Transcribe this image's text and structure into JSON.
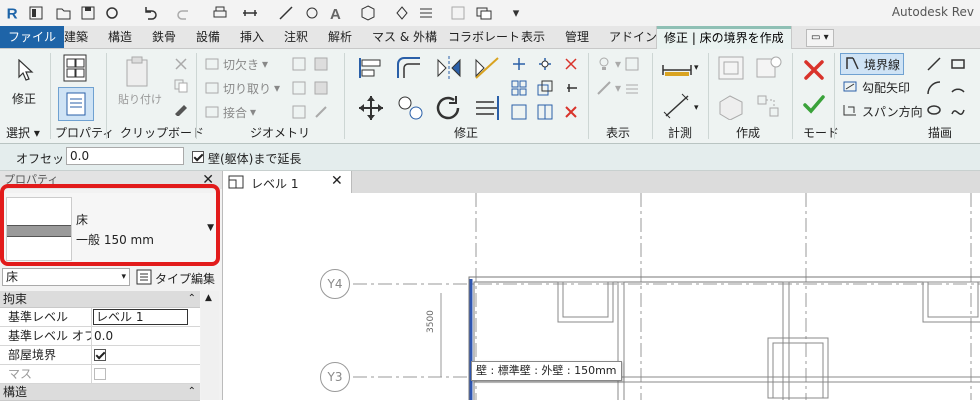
{
  "app": {
    "title": "Autodesk Rev"
  },
  "tabs": [
    {
      "label": "ファイル"
    },
    {
      "label": "建築"
    },
    {
      "label": "構造"
    },
    {
      "label": "鉄骨"
    },
    {
      "label": "設備"
    },
    {
      "label": "挿入"
    },
    {
      "label": "注釈"
    },
    {
      "label": "解析"
    },
    {
      "label": "マス & 外構"
    },
    {
      "label": "コラボレート"
    },
    {
      "label": "表示"
    },
    {
      "label": "管理"
    },
    {
      "label": "アドイン"
    },
    {
      "label": "修正 | 床の境界を作成"
    }
  ],
  "ribbon": {
    "panels": {
      "select": "選択 ▾",
      "properties": "プロパティ",
      "clipboard": "クリップボード",
      "geometry": "ジオメトリ",
      "modify": "修正",
      "view": "表示",
      "measure": "計測",
      "create": "作成",
      "mode": "モード",
      "draw": "描画"
    },
    "modify_button": "修正",
    "paste_button": "貼り付け",
    "geometry_items": {
      "cut": "切欠き",
      "uncut": "切り取り",
      "join": "接合"
    },
    "draw_items": {
      "boundary": "境界線",
      "slope_arrow": "勾配矢印",
      "span_direction": "スパン方向"
    }
  },
  "options_bar": {
    "offset_label": "オフセット:",
    "offset_value": "0.0",
    "extend_label": "壁(躯体)まで延長",
    "extend_checked": true
  },
  "properties": {
    "header": "プロパティ",
    "type_name": "床",
    "type_subname": "一般 150 mm",
    "instance_selector": "床",
    "type_edit": "タイプ編集",
    "categories": [
      {
        "name": "拘束",
        "rows": [
          {
            "name": "基準レベル",
            "value": "レベル 1",
            "boxed": true
          },
          {
            "name": "基準レベル オフ...",
            "value": "0.0"
          },
          {
            "name": "部屋境界",
            "value": "",
            "checkbox": true,
            "checked": true
          },
          {
            "name": "マス",
            "value": "",
            "checkbox": true,
            "checked": false,
            "disabled": true
          }
        ]
      },
      {
        "name": "構造",
        "rows": []
      }
    ]
  },
  "view": {
    "tab_label": "レベル 1",
    "grid_labels": {
      "y4": "Y4",
      "y3": "Y3"
    },
    "dimension": "3500",
    "tooltip": "壁 : 標準壁 : 外壁 : 150mm"
  },
  "colors": {
    "file_tab": "#1e64a8",
    "highlight": "#e21b1b",
    "boundary_line": "#2f56b0",
    "cancel": "#d9332b",
    "finish": "#3aa23a"
  }
}
